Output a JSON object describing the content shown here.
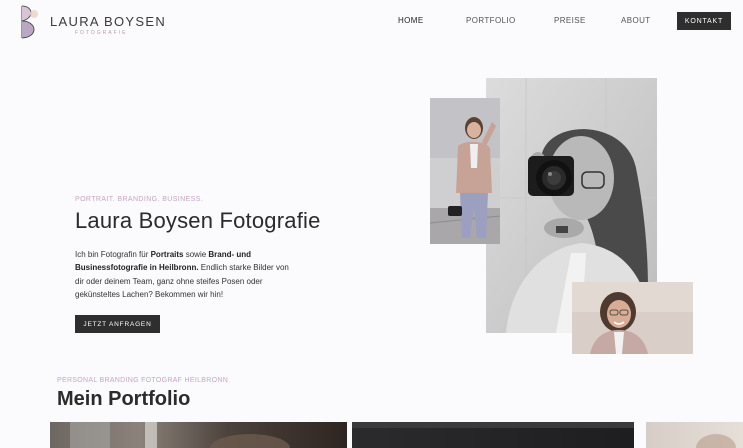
{
  "brand": {
    "name": "LAURA BOYSEN",
    "subtitle": "FOTOGRAFIE"
  },
  "nav": {
    "items": [
      "HOME",
      "PORTFOLIO",
      "PREISE",
      "ABOUT"
    ],
    "cta": "KONTAKT"
  },
  "hero": {
    "eyebrow": "PORTRAIT. BRANDING. BUSINESS.",
    "title": "Laura Boysen Fotografie",
    "text_parts": [
      "Ich bin Fotografin für ",
      "Portraits",
      " sowie ",
      "Brand- und Businessfotografie in Heilbronn.",
      " Endlich starke Bilder von dir oder deinem Team, ganz ohne steifes Posen oder gekünsteltes Lachen? Bekommen wir hin!"
    ],
    "button": "JETZT ANFRAGEN"
  },
  "portfolio": {
    "eyebrow": "PERSONAL BRANDING FOTOGRAF HEILBRONN",
    "title": "Mein Portfolio"
  },
  "colors": {
    "accent": "#c6a6c7",
    "dark_button": "#2e2e2e",
    "background": "#fbfafc"
  }
}
